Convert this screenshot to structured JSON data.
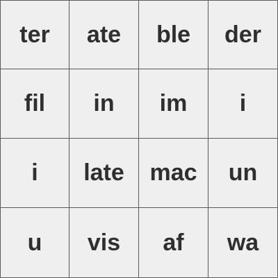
{
  "grid": {
    "rows": [
      [
        "ter",
        "ate",
        "ble",
        "der"
      ],
      [
        "fil",
        "in",
        "im",
        "i"
      ],
      [
        "i",
        "late",
        "mac",
        "un"
      ],
      [
        "u",
        "vis",
        "af",
        "wa"
      ]
    ]
  },
  "colors": {
    "tile_background": "#efefef",
    "tile_border": "#5a5a5a",
    "text": "#2f2f2f"
  }
}
